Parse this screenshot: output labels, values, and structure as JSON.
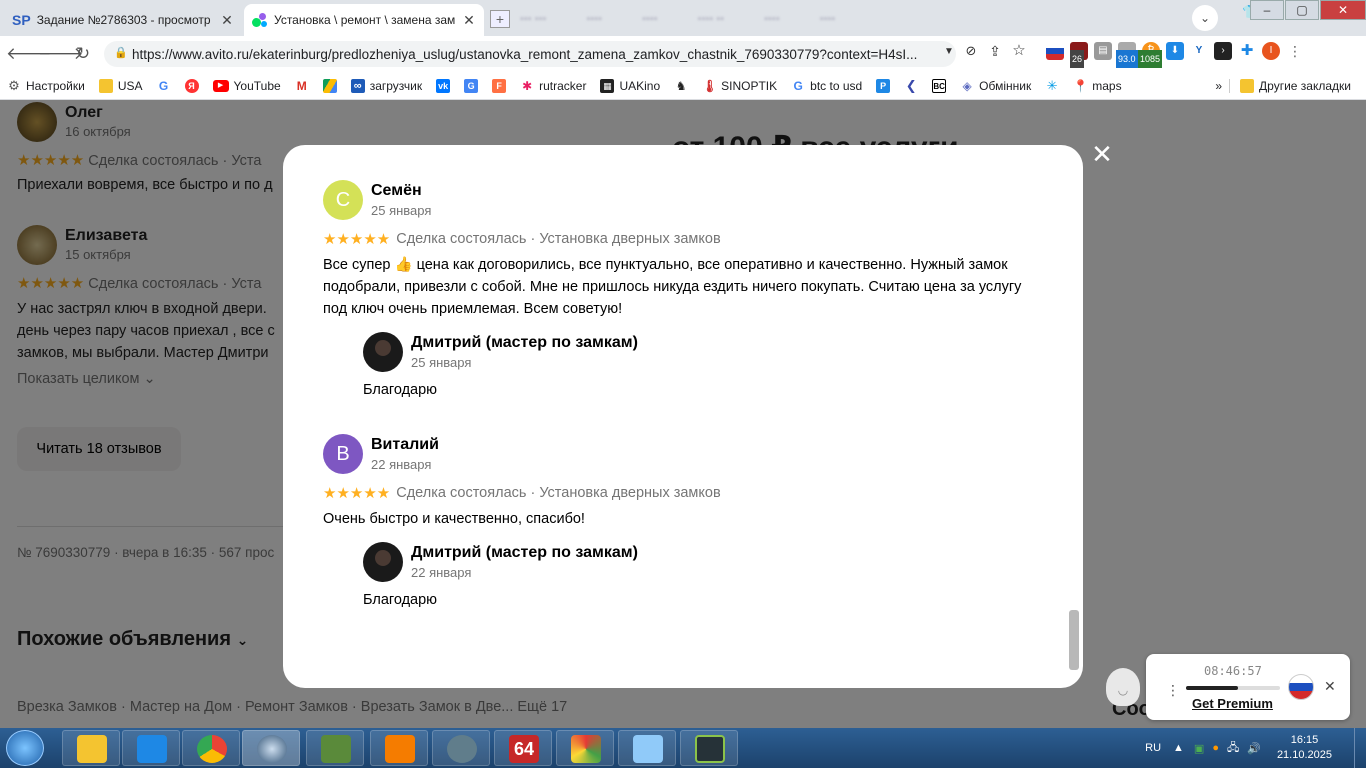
{
  "browser": {
    "tabs": [
      {
        "favicon": "SP",
        "title": "Задание №2786303 - просмотр з",
        "active": false
      },
      {
        "favicon": "avito",
        "title": "Установка \\ ремонт \\ замена зам",
        "active": true
      }
    ],
    "url": "https://www.avito.ru/ekaterinburg/predlozheniya_uslug/ustanovka_remont_zamena_zamkov_chastnik_7690330779?context=H4sI...",
    "extensions": {
      "badge_26": "26",
      "badge_93": "93.0",
      "badge_1085": "1085"
    },
    "bookmarks": [
      {
        "label": "Настройки",
        "icon": "gear-icon"
      },
      {
        "label": "USA",
        "icon": "folder-icon"
      },
      {
        "label": "",
        "icon": "google-icon"
      },
      {
        "label": "",
        "icon": "yandex-icon"
      },
      {
        "label": "YouTube",
        "icon": "youtube-icon"
      },
      {
        "label": "",
        "icon": "gmail-icon"
      },
      {
        "label": "",
        "icon": "drive-icon"
      },
      {
        "label": "загрузчик",
        "icon": "infinity-icon"
      },
      {
        "label": "",
        "icon": "vk-icon"
      },
      {
        "label": "",
        "icon": "translate-icon"
      },
      {
        "label": "",
        "icon": "f-icon"
      },
      {
        "label": "rutracker",
        "icon": "rutracker-icon"
      },
      {
        "label": "UAKino",
        "icon": "uakino-icon"
      },
      {
        "label": "",
        "icon": "chess-icon"
      },
      {
        "label": "SINOPTIK",
        "icon": "thermometer-icon"
      },
      {
        "label": "btc to usd",
        "icon": "google-icon"
      },
      {
        "label": "",
        "icon": "p-icon"
      },
      {
        "label": "",
        "icon": "arrow-icon"
      },
      {
        "label": "",
        "icon": "bc-icon"
      },
      {
        "label": "Обмінник",
        "icon": "exchange-icon"
      },
      {
        "label": "",
        "icon": "snowflake-icon"
      },
      {
        "label": "maps",
        "icon": "maps-icon"
      }
    ],
    "bookmarks_more": "»",
    "other_bookmarks": "Другие закладки"
  },
  "background": {
    "reviews": [
      {
        "name": "Олег",
        "date": "16 октября",
        "meta": "Сделка состоялась · Уста",
        "text": "Приехали вовремя, все быстро и по д"
      },
      {
        "name": "Елизавета",
        "date": "15 октября",
        "meta": "Сделка состоялась · Уста",
        "text_lines": [
          "У нас застрял ключ в входной двери.",
          "день через пару часов приехал , все с",
          "замков, мы выбрали. Мастер Дмитри"
        ]
      }
    ],
    "show_full": "Показать целиком",
    "read_reviews_button": "Читать 18 отзывов",
    "listing_info": "№ 7690330779 · вчера в 16:35 · 567 прос",
    "similar_heading": "Похожие объявления",
    "tags": "Врезка Замков · Мастер на Дом · Ремонт Замков · Врезать Замок в Две...  Ещё 17",
    "heading_partial": "от 100 ₽ все услуги",
    "bottom_right": "Соо"
  },
  "modal": {
    "reviews": [
      {
        "initial": "С",
        "avatar_color": "#d4e157",
        "name": "Семён",
        "date": "25 января",
        "deal": "Сделка состоялась · Установка дверных замков",
        "text": "Все супер 👍 цена как договорились, все пунктуально, все оперативно и качественно. Нужный замок подобрали, привезли с собой. Мне не пришлось никуда ездить ничего покупать. Считаю цена за услугу под ключ очень приемлемая. Всем советую!",
        "reply": {
          "name": "Дмитрий (мастер по замкам)",
          "date": "25 января",
          "text": "Благодарю"
        }
      },
      {
        "initial": "В",
        "avatar_color": "#7e57c2",
        "name": "Виталий",
        "date": "22 января",
        "deal": "Сделка состоялась · Установка дверных замков",
        "text": "Очень быстро и качественно, спасибо!",
        "reply": {
          "name": "Дмитрий (мастер по замкам)",
          "date": "22 января",
          "text": "Благодарю"
        }
      }
    ],
    "stars": "★★★★★"
  },
  "vpn_popup": {
    "time": "08:46:57",
    "link": "Get Premium"
  },
  "taskbar": {
    "lang": "RU",
    "time": "16:15",
    "date": "21.10.2025"
  }
}
